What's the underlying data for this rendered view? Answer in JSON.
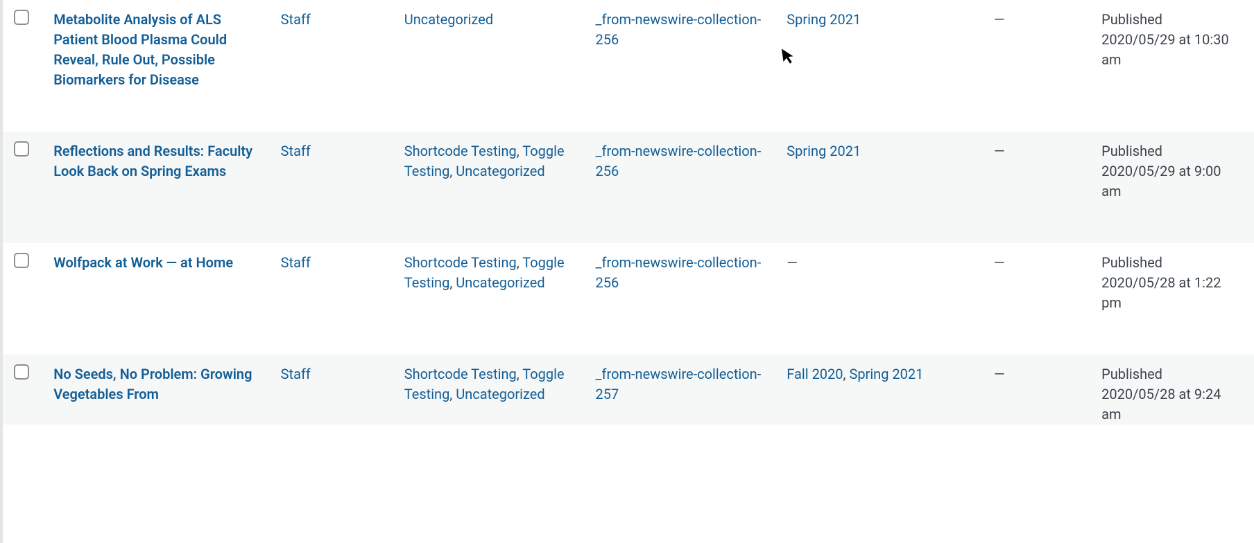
{
  "dash": "—",
  "rows": [
    {
      "title": "Metabolite Analysis of ALS Patient Blood Plasma Could Reveal, Rule Out, Possible Biomarkers for Disease",
      "author": "Staff",
      "categories": [
        "Uncategorized"
      ],
      "tags": [
        "_from-newswire-collection-256"
      ],
      "issues": [
        "Spring 2021"
      ],
      "comments": "—",
      "date_status": "Published",
      "date_line": "2020/05/29 at 10:30 am",
      "alt": false
    },
    {
      "title": "Reflections and Results: Faculty Look Back on Spring Exams",
      "author": "Staff",
      "categories": [
        "Shortcode Testing",
        "Toggle Testing",
        "Uncategorized"
      ],
      "tags": [
        "_from-newswire-collection-256"
      ],
      "issues": [
        "Spring 2021"
      ],
      "comments": "—",
      "date_status": "Published",
      "date_line": "2020/05/29 at 9:00 am",
      "alt": true
    },
    {
      "title": "Wolfpack at Work — at Home",
      "author": "Staff",
      "categories": [
        "Shortcode Testing",
        "Toggle Testing",
        "Uncategorized"
      ],
      "tags": [
        "_from-newswire-collection-256"
      ],
      "issues": [],
      "comments": "—",
      "date_status": "Published",
      "date_line": "2020/05/28 at 1:22 pm",
      "alt": false
    },
    {
      "title": "No Seeds, No Problem: Growing Vegetables From",
      "author": "Staff",
      "categories": [
        "Shortcode Testing",
        "Toggle Testing",
        "Uncategorized"
      ],
      "tags": [
        "_from-newswire-collection-257"
      ],
      "issues": [
        "Fall 2020",
        "Spring 2021"
      ],
      "comments": "—",
      "date_status": "Published",
      "date_line": "2020/05/28 at 9:24 am",
      "alt": true,
      "cut": true
    }
  ]
}
